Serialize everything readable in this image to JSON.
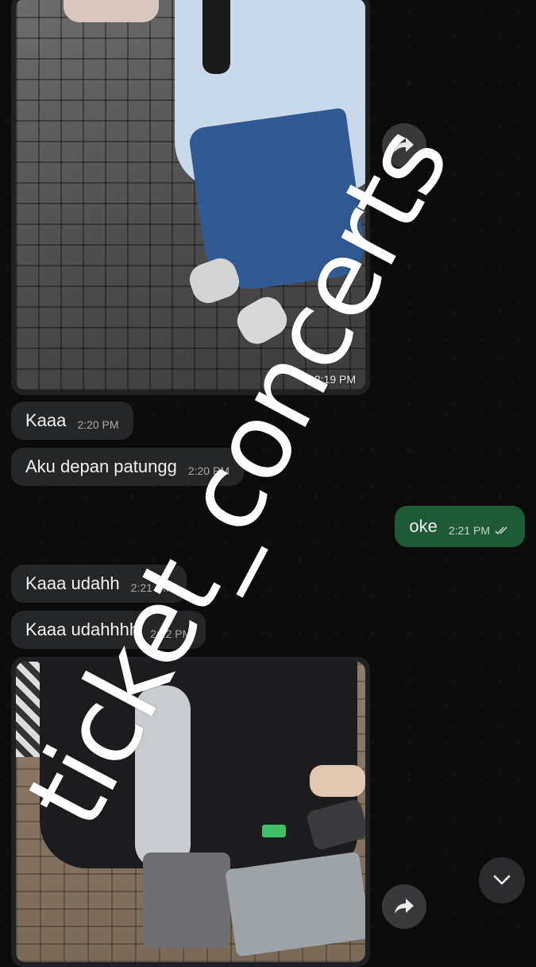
{
  "messages": [
    {
      "type": "image",
      "direction": "in",
      "time": "2:19 PM"
    },
    {
      "type": "text",
      "direction": "in",
      "text": "Kaaa",
      "time": "2:20 PM"
    },
    {
      "type": "text",
      "direction": "in",
      "text": "Aku depan patungg",
      "time": "2:20 PM"
    },
    {
      "type": "text",
      "direction": "out",
      "text": "oke",
      "time": "2:21 PM",
      "status": "read"
    },
    {
      "type": "text",
      "direction": "in",
      "text": "Kaaa udahh",
      "time": "2:21 PM"
    },
    {
      "type": "text",
      "direction": "in",
      "text": "Kaaa udahhhh",
      "time": "2:22 PM"
    },
    {
      "type": "image",
      "direction": "in",
      "time": ""
    }
  ],
  "watermark": "ticket_concerts",
  "icons": {
    "forward": "forward-arrow-icon",
    "scroll": "chevron-down-icon",
    "read": "double-check-icon"
  },
  "colors": {
    "background": "#0b0b0b",
    "incoming_bubble": "#252628",
    "outgoing_bubble": "#1e5a36"
  }
}
